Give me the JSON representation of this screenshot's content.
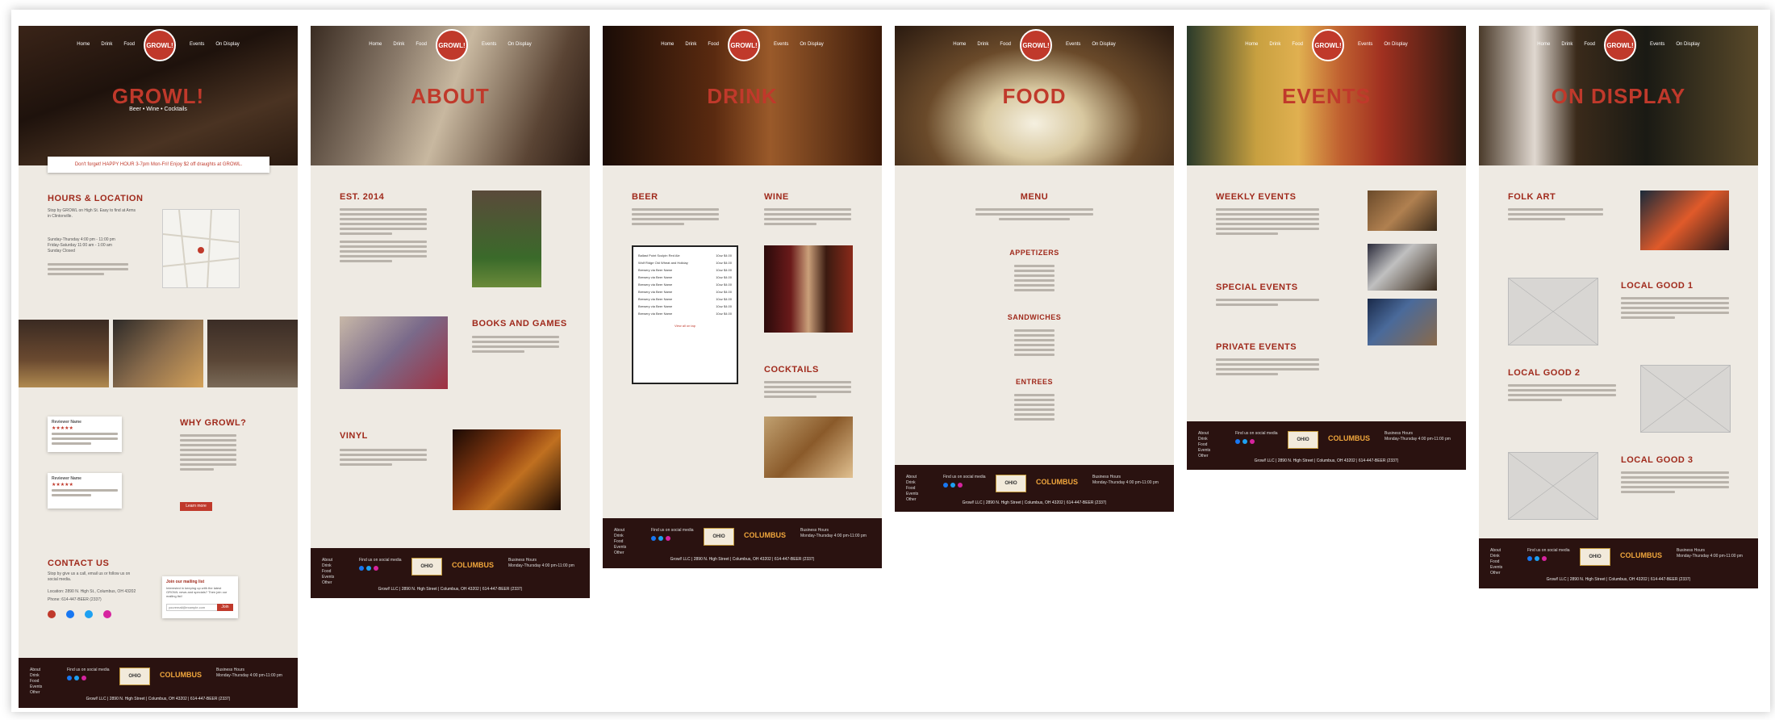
{
  "nav": [
    "Home",
    "Drink",
    "Food",
    "Events",
    "On Display"
  ],
  "logo_text": "GROWL!",
  "colors": {
    "accent": "#c0392b",
    "footer": "#2a1210",
    "page_bg": "#eeeae3"
  },
  "pages": {
    "home": {
      "hero_title": "GROWL!",
      "hero_sub": "Beer • Wine • Cocktails",
      "banner": "Don't forget! HAPPY HOUR 3-7pm Mon-Fri! Enjoy $2 off draughts at GROWL.",
      "hours_heading": "HOURS & LOCATION",
      "hours_text": "Stop by GROWL on High St. Easy to find at Arms in Clintonville.",
      "hours_lines": [
        "Sunday-Thursday 4:00 pm - 11:00 pm",
        "Friday-Saturday 11:00 am - 1:00 am",
        "Sunday Closed"
      ],
      "why_heading": "WHY GROWL?",
      "review_title": "Reviewer Name",
      "stars": "★★★★★",
      "learn_more": "Learn more",
      "contact_heading": "CONTACT US",
      "contact_text": "Stop by give us a call, email us or follow us on social media.",
      "contact_location": "Location: 2890 N. High St., Columbus, OH 43202",
      "contact_phone": "Phone: 614-447-BEER (2337)",
      "mailing_heading": "Join our mailing list",
      "mailing_text": "Interested in keeping up with the latest GROWL news and specials? Then join our mailing list!",
      "mailing_placeholder": "youremail@example.com",
      "join": "Join"
    },
    "about": {
      "hero_title": "ABOUT",
      "h1": "EST. 2014",
      "h2": "BOOKS AND GAMES",
      "h3": "VINYL"
    },
    "drink": {
      "hero_title": "DRINK",
      "beer": "BEER",
      "wine": "WINE",
      "cocktails": "COCKTAILS",
      "menu_rows": [
        {
          "name": "Ballast Point Sculpin Red Ale",
          "price": "10oz $4.00"
        },
        {
          "name": "Wolf Ridge Old Wheat and Holiday",
          "price": "10oz $4.00"
        },
        {
          "name": "Brewery via Beer Name",
          "price": "10oz $4.00"
        },
        {
          "name": "Brewery via Beer Name",
          "price": "10oz $4.00"
        },
        {
          "name": "Brewery via Beer Name",
          "price": "10oz $4.00"
        },
        {
          "name": "Brewery via Beer Name",
          "price": "10oz $4.00"
        },
        {
          "name": "Brewery via Beer Name",
          "price": "10oz $4.00"
        },
        {
          "name": "Brewery via Beer Name",
          "price": "10oz $4.00"
        },
        {
          "name": "Brewery via Beer Name",
          "price": "10oz $4.00"
        }
      ],
      "view_all": "View all on tap"
    },
    "food": {
      "hero_title": "FOOD",
      "menu": "MENU",
      "appetizers": "APPETIZERS",
      "sandwiches": "SANDWICHES",
      "entrees": "ENTREES"
    },
    "events": {
      "hero_title": "EVENTS",
      "weekly": "WEEKLY EVENTS",
      "special": "SPECIAL EVENTS",
      "private": "PRIVATE EVENTS"
    },
    "display": {
      "hero_title": "ON DISPLAY",
      "folk": "FOLK ART",
      "lg1": "LOCAL GOOD 1",
      "lg2": "LOCAL GOOD 2",
      "lg3": "LOCAL GOOD 3"
    }
  },
  "footer": {
    "links": [
      "About",
      "Drink",
      "Food",
      "Events",
      "Other"
    ],
    "social_heading": "Find us on social media",
    "ohio_badge": "OHIO",
    "cbus_badge": "COLUMBUS",
    "hours_heading": "Business Hours",
    "hours_text": "Monday-Thursday 4:00 pm-11:00 pm",
    "address": "Growl! LLC | 2890 N. High Street | Columbus, OH 43202 | 614-447-BEER (2337)"
  }
}
